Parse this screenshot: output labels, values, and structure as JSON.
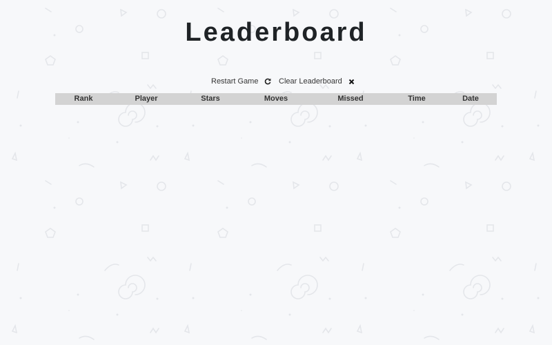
{
  "page": {
    "title": "Leaderboard"
  },
  "controls": {
    "restart_label": "Restart Game",
    "restart_icon": "refresh-icon",
    "clear_label": "Clear Leaderboard",
    "clear_icon": "close-icon"
  },
  "leaderboard": {
    "columns": [
      "Rank",
      "Player",
      "Stars",
      "Moves",
      "Missed",
      "Time",
      "Date"
    ],
    "rows": []
  },
  "colors": {
    "background": "#f7f8fa",
    "header_bg": "#d3d3d3",
    "title_color": "#1f2326"
  }
}
